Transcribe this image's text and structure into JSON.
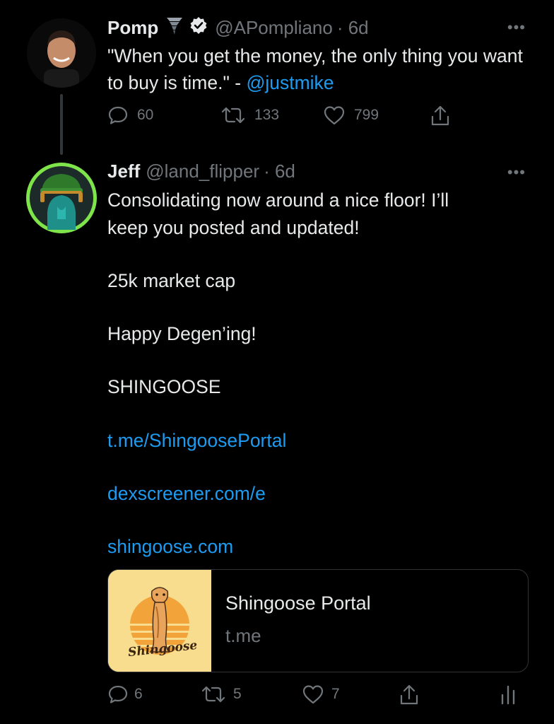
{
  "tweet1": {
    "name": "Pomp",
    "handle": "@APompliano",
    "time": "· 6d",
    "text_before_link": "\"When you get the money, the only thing you want to buy is time.\" - ",
    "mention": "@justmike",
    "replies": "60",
    "retweets": "133",
    "likes": "799"
  },
  "tweet2": {
    "name": "Jeff",
    "handle": "@land_flipper",
    "time": "· 6d",
    "line1": "Consolidating now around a nice floor! I’ll",
    "line2": "keep you posted and updated!",
    "line3": "25k market cap",
    "line4": "Happy Degen’ing!",
    "line5": "SHINGOOSE",
    "link1": "t.me/ShingoosePortal",
    "link2": "dexscreener.com/e",
    "link3": "shingoose.com",
    "card": {
      "title": "Shingoose Portal",
      "domain": "t.me",
      "logo_text": "Shingoose"
    },
    "replies": "6",
    "retweets": "5",
    "likes": "7"
  },
  "colors": {
    "background": "#000000",
    "text": "#e7e9ea",
    "muted": "#71767b",
    "link": "#1d9bf0",
    "avatar_ring": "#7fe34a"
  },
  "icons": [
    "tornado-emoji-icon",
    "verified-badge-icon",
    "more-icon",
    "reply-icon",
    "retweet-icon",
    "like-icon",
    "share-icon",
    "analytics-icon"
  ]
}
